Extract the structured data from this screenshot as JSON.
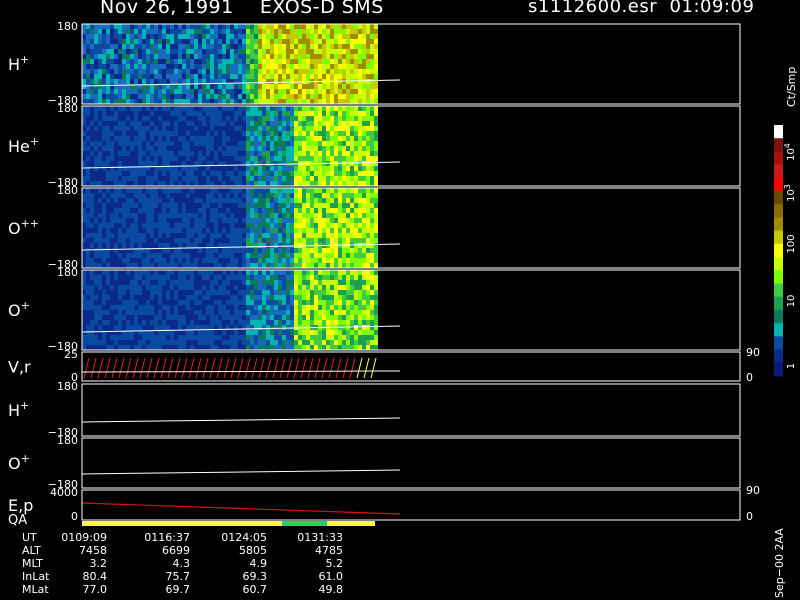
{
  "header": {
    "title": "Nov 26, 1991    EXOS-D SMS",
    "file": "s1112600.esr  01:09:09"
  },
  "panels": [
    {
      "id": "h1",
      "label": "H",
      "sup": "+",
      "ytop": "180",
      "ybot": "−180"
    },
    {
      "id": "he",
      "label": "He",
      "sup": "+",
      "ytop": "180",
      "ybot": "−180"
    },
    {
      "id": "opp",
      "label": "O",
      "sup": "++",
      "ytop": "180",
      "ybot": "−180"
    },
    {
      "id": "o1",
      "label": "O",
      "sup": "+",
      "ytop": "180",
      "ybot": "−180"
    },
    {
      "id": "vr",
      "label": "V,r",
      "sup": "",
      "ytop": "25",
      "ybot": "0",
      "rtop": "90",
      "rbot": "0"
    },
    {
      "id": "h2",
      "label": "H",
      "sup": "+",
      "ytop": "180",
      "ybot": "−180"
    },
    {
      "id": "o2",
      "label": "O",
      "sup": "+",
      "ytop": "180",
      "ybot": "−180"
    },
    {
      "id": "ep",
      "label": "E,p",
      "sup": "",
      "ytop": "4000",
      "ybot": "0",
      "rtop": "90",
      "rbot": "0"
    }
  ],
  "qa_label": "QA",
  "colorbar": {
    "unit": "Ct/Smp",
    "ticks": [
      "10",
      "100",
      "1",
      "10",
      "10",
      "1"
    ],
    "tick_labels": [
      {
        "text": "10",
        "exp": "4"
      },
      {
        "text": "10",
        "exp": "3"
      },
      {
        "text": "100",
        "exp": ""
      },
      {
        "text": "10",
        "exp": ""
      },
      {
        "text": "1",
        "exp": ""
      }
    ],
    "colors": [
      "#ffffff",
      "#7a1010",
      "#a80f0f",
      "#cc1a1a",
      "#ff0000",
      "#6b4a00",
      "#8a6d00",
      "#a08c00",
      "#c8c800",
      "#ffff00",
      "#c8ff00",
      "#7fff00",
      "#3fcc3f",
      "#1fa04f",
      "#0a7a5a",
      "#00b4b4",
      "#0a4aa0",
      "#0a2a8a",
      "#0a1a7a"
    ]
  },
  "side_note": "Sep−00 2AA",
  "table": {
    "labels": [
      "UT",
      "ALT",
      "MLT",
      "InLat",
      "MLat"
    ],
    "columns": [
      [
        "0109:09",
        "7458",
        "3.2",
        "80.4",
        "77.0"
      ],
      [
        "0116:37",
        "6699",
        "4.3",
        "75.7",
        "69.7"
      ],
      [
        "0124:05",
        "5805",
        "4.9",
        "69.3",
        "60.7"
      ],
      [
        "0131:33",
        "4785",
        "5.2",
        "61.0",
        "49.8"
      ]
    ]
  },
  "colors": {
    "background": "#000000",
    "frame": "#ffffff",
    "qa_yellow": "#ffff33",
    "qa_green": "#33cc55",
    "ep_line": "#dd1111",
    "vr_red": "#dd2222",
    "vr_yellow": "#ffff44"
  },
  "chart_data": {
    "type": "heatmap",
    "title": "Nov 26, 1991    EXOS-D SMS",
    "x_ticks": [
      "0109:09",
      "0116:37",
      "0124:05",
      "0131:33"
    ],
    "panels": [
      "H+",
      "He+",
      "O++",
      "O+",
      "V,r",
      "H+",
      "O+",
      "E,p"
    ],
    "colorscale_unit": "Ct/Smp",
    "colorscale": "log",
    "colorscale_range": [
      1,
      10000
    ],
    "grid": false
  }
}
